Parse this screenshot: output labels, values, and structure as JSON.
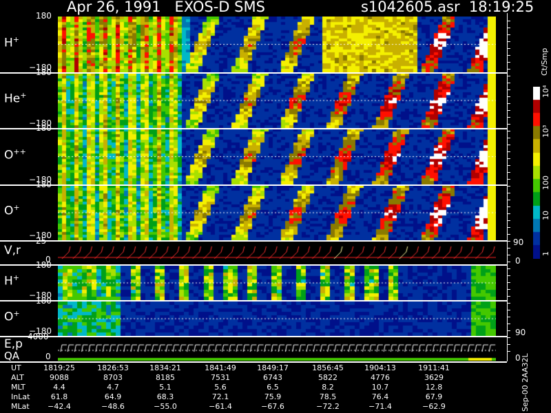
{
  "header": {
    "title_left": "Apr 26, 1991   EXOS-D SMS",
    "title_right": "s1042605.asr  18:19:25"
  },
  "panels": [
    {
      "id": "h_plus",
      "label": "H",
      "sup": "+",
      "ytop": "180",
      "ybot": "−180"
    },
    {
      "id": "he_plus",
      "label": "He",
      "sup": "+",
      "ytop": "180",
      "ybot": "−180"
    },
    {
      "id": "o_pp",
      "label": "O",
      "sup": "++",
      "ytop": "180",
      "ybot": "−180"
    },
    {
      "id": "o_plus",
      "label": "O",
      "sup": "+",
      "ytop": "180",
      "ybot": "−180"
    },
    {
      "id": "vr",
      "label": "V,r",
      "sup": "",
      "ytop": "25",
      "ybot": "0",
      "right_top": "90",
      "right_bot": "0"
    },
    {
      "id": "h_plus_2",
      "label": "H",
      "sup": "+",
      "ytop": "180",
      "ybot": "−180"
    },
    {
      "id": "o_plus_2",
      "label": "O",
      "sup": "+",
      "ytop": "180",
      "ybot": "−180",
      "right_bot": "90"
    },
    {
      "id": "ep",
      "label": "E,p",
      "sub_label": "QA",
      "ytop": "4000",
      "ybot": "0",
      "right_bot": "0"
    }
  ],
  "colorbar": {
    "unit": "Ct/Smp",
    "ticks": [
      "10⁴",
      "10³",
      "100",
      "10",
      "1"
    ],
    "colors": [
      "#ffffff",
      "#b00000",
      "#ff1000",
      "#8a7a00",
      "#c8b000",
      "#f4f000",
      "#a8e000",
      "#44c800",
      "#00a018",
      "#00b8c8",
      "#0078b4",
      "#0030a0",
      "#00108a"
    ]
  },
  "chart_data": {
    "type": "heatmap",
    "title": "Apr 26, 1991   EXOS-D SMS",
    "x": {
      "label": "UT",
      "ticks": [
        "1819:25",
        "1826:53",
        "1834:21",
        "1841:49",
        "1849:17",
        "1856:45",
        "1904:13",
        "1911:41"
      ]
    },
    "series": [
      {
        "name": "H+",
        "ylim": [
          -180,
          180
        ]
      },
      {
        "name": "He+",
        "ylim": [
          -180,
          180
        ]
      },
      {
        "name": "O++",
        "ylim": [
          -180,
          180
        ]
      },
      {
        "name": "O+",
        "ylim": [
          -180,
          180
        ]
      },
      {
        "name": "V,r",
        "ylim": [
          0,
          25
        ]
      },
      {
        "name": "H+",
        "ylim": [
          -180,
          180
        ]
      },
      {
        "name": "O+",
        "ylim": [
          -180,
          180
        ]
      },
      {
        "name": "E,p",
        "ylim": [
          0,
          4000
        ]
      }
    ],
    "colorscale": {
      "label": "Ct/Smp",
      "ticks": [
        1,
        10,
        100,
        1000,
        10000
      ]
    }
  },
  "orbit_table": {
    "rows": [
      {
        "key": "UT",
        "values": [
          "1819:25",
          "1826:53",
          "1834:21",
          "1841:49",
          "1849:17",
          "1856:45",
          "1904:13",
          "1911:41"
        ]
      },
      {
        "key": "ALT",
        "values": [
          "9088",
          "8703",
          "8185",
          "7531",
          "6743",
          "5822",
          "4776",
          "3629"
        ]
      },
      {
        "key": "MLT",
        "values": [
          "4.4",
          "4.7",
          "5.1",
          "5.6",
          "6.5",
          "8.2",
          "10.7",
          "12.8"
        ]
      },
      {
        "key": "InLat",
        "values": [
          "61.8",
          "64.9",
          "68.3",
          "72.1",
          "75.9",
          "78.5",
          "76.4",
          "67.9"
        ]
      },
      {
        "key": "MLat",
        "values": [
          "−42.4",
          "−48.6",
          "−55.0",
          "−61.4",
          "−67.6",
          "−72.2",
          "−71.4",
          "−62.9"
        ]
      }
    ]
  },
  "stamp": "Sep-00 2AA32L"
}
